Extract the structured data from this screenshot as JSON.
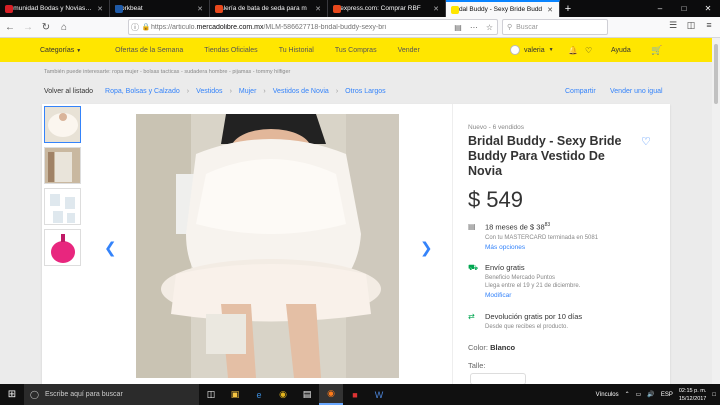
{
  "browser": {
    "tabs": [
      {
        "label": "Comunidad Bodas y Novias - bo",
        "icon_color": "#d81f26",
        "active": false
      },
      {
        "label": "Workbeat",
        "icon_color": "#1e5aa8",
        "active": false
      },
      {
        "label": "Galería de bata de seda para m",
        "icon_color": "#e8481c",
        "active": false
      },
      {
        "label": "Aliexpress.com: Comprar RBF",
        "icon_color": "#e8481c",
        "active": false
      },
      {
        "label": "Bridal Buddy - Sexy Bride Budd",
        "icon_color": "#ffe600",
        "active": true
      }
    ],
    "new_tab": "+",
    "url_prefix": "https://articulo.",
    "url_domain": "mercadolibre.com.mx",
    "url_rest": "/MLM-586627718-bridal-buddy-sexy-bri",
    "search_placeholder": "Buscar"
  },
  "ml_header": {
    "categories": "Categorías",
    "nav": [
      "Ofertas de la Semana",
      "Tiendas Oficiales",
      "Tu Historial",
      "Tus Compras",
      "Vender"
    ],
    "user": "valeria",
    "help": "Ayuda"
  },
  "interest_text": "También puede interesarte: ropa mujer - bolsas tacticas - sudadera hombre - pijamas - tommy hilfiger",
  "breadcrumb": {
    "back": "Volver al listado",
    "items": [
      "Ropa, Bolsas y Calzado",
      "Vestidos",
      "Mujer",
      "Vestidos de Novia",
      "Otros Largos"
    ]
  },
  "share": "Compartir",
  "sell_same": "Vender uno igual",
  "product": {
    "condition": "Nuevo  -  6 vendidos",
    "title": "Bridal Buddy - Sexy Bride Buddy Para Vestido De Novia",
    "currency": "$",
    "price": "549",
    "installments": "18 meses de $ 38",
    "installments_cents": "83",
    "installments_note": "Con tu MASTERCARD terminada en 5081",
    "installments_link": "Más opciones",
    "shipping_title": "Envío gratis",
    "shipping_sub": "Beneficio Mercado Puntos",
    "shipping_date": "Llega entre el 19 y 21 de diciembre.",
    "shipping_link": "Modificar",
    "returns_title": "Devolución gratis por 10 días",
    "returns_sub": "Desde que recibes el producto.",
    "color_label": "Color:",
    "color_value": "Blanco",
    "size_label": "Talle:"
  },
  "taskbar": {
    "search_placeholder": "Escribe aquí para buscar",
    "tray_label": "Vínculos",
    "lang": "ESP",
    "time": "02:15 p. m.",
    "date": "15/12/2017"
  },
  "colors": {
    "ml_yellow": "#ffe600",
    "ml_blue": "#3483fa",
    "ml_green": "#00a650"
  }
}
